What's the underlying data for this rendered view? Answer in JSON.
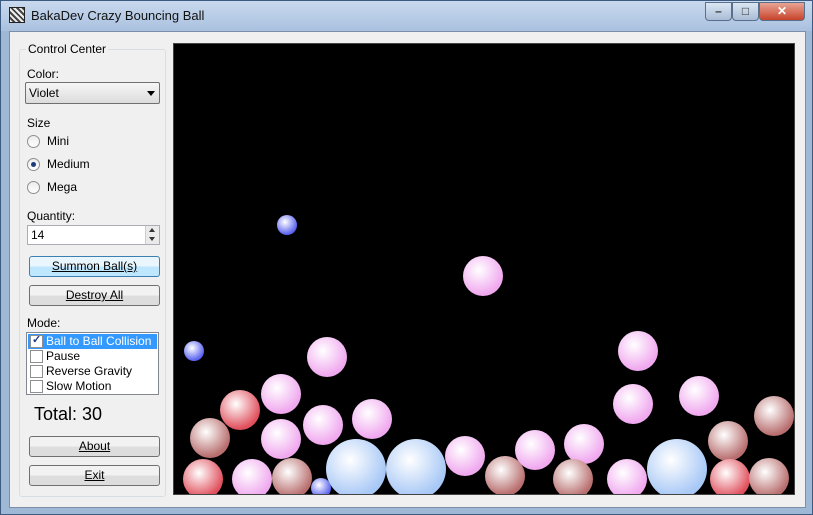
{
  "window": {
    "title": "BakaDev Crazy Bouncing Ball",
    "minimize": "–",
    "maximize": "□",
    "close": "✕"
  },
  "control_center": {
    "title": "Control Center",
    "color_label": "Color:",
    "color_value": "Violet",
    "size_label": "Size",
    "sizes": [
      {
        "label": "Mini",
        "checked": false
      },
      {
        "label": "Medium",
        "checked": true
      },
      {
        "label": "Mega",
        "checked": false
      }
    ],
    "quantity_label": "Quantity:",
    "quantity_value": "14",
    "summon_label": "Summon Ball(s)",
    "destroy_label": "Destroy All",
    "mode_label": "Mode:",
    "modes": [
      {
        "label": "Ball to Ball Collision",
        "checked": true,
        "selected": true
      },
      {
        "label": "Pause",
        "checked": false,
        "selected": false
      },
      {
        "label": "Reverse Gravity",
        "checked": false,
        "selected": false
      },
      {
        "label": "Slow Motion",
        "checked": false,
        "selected": false
      }
    ],
    "total_text": "Total: 30",
    "about_label": "About",
    "exit_label": "Exit"
  },
  "ball_colors": {
    "violet": "#f0a8ef",
    "blue": "#5a63f0",
    "light_blue": "#a8c8f6",
    "red": "#e0505d",
    "brown": "#b86e6e"
  }
}
